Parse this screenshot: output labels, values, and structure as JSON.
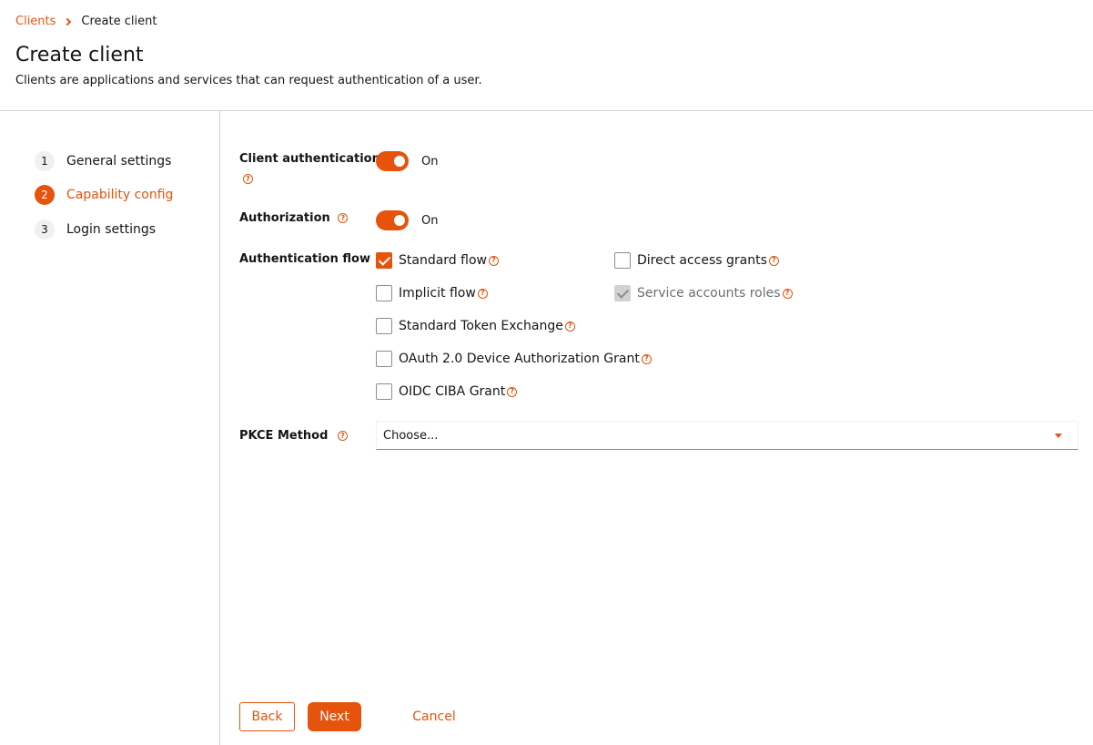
{
  "breadcrumb": {
    "parent": "Clients",
    "current": "Create client"
  },
  "page": {
    "title": "Create client",
    "description": "Clients are applications and services that can request authentication of a user."
  },
  "wizard": {
    "steps": [
      {
        "number": "1",
        "label": "General settings",
        "active": false
      },
      {
        "number": "2",
        "label": "Capability config",
        "active": true
      },
      {
        "number": "3",
        "label": "Login settings",
        "active": false
      }
    ]
  },
  "form": {
    "client_authentication": {
      "label": "Client authentication",
      "state_text": "On",
      "on": true
    },
    "authorization": {
      "label": "Authorization",
      "state_text": "On",
      "on": true
    },
    "authentication_flow": {
      "label": "Authentication flow",
      "options": [
        {
          "label": "Standard flow",
          "checked": true,
          "disabled": false
        },
        {
          "label": "Direct access grants",
          "checked": false,
          "disabled": false
        },
        {
          "label": "Implicit flow",
          "checked": false,
          "disabled": false
        },
        {
          "label": "Service accounts roles",
          "checked": true,
          "disabled": true
        },
        {
          "label": "Standard Token Exchange",
          "checked": false,
          "disabled": false
        },
        {
          "label": "OAuth 2.0 Device Authorization Grant",
          "checked": false,
          "disabled": false
        },
        {
          "label": "OIDC CIBA Grant",
          "checked": false,
          "disabled": false
        }
      ]
    },
    "pkce_method": {
      "label": "PKCE Method",
      "value": "Choose..."
    }
  },
  "actions": {
    "back": "Back",
    "next": "Next",
    "cancel": "Cancel"
  },
  "colors": {
    "accent": "#e5530d",
    "border": "#d2d2d2",
    "text": "#151515"
  },
  "icons": {
    "help": "help-circle-icon",
    "breadcrumb_separator": "chevron-right-icon",
    "select_caret": "caret-down-icon"
  }
}
